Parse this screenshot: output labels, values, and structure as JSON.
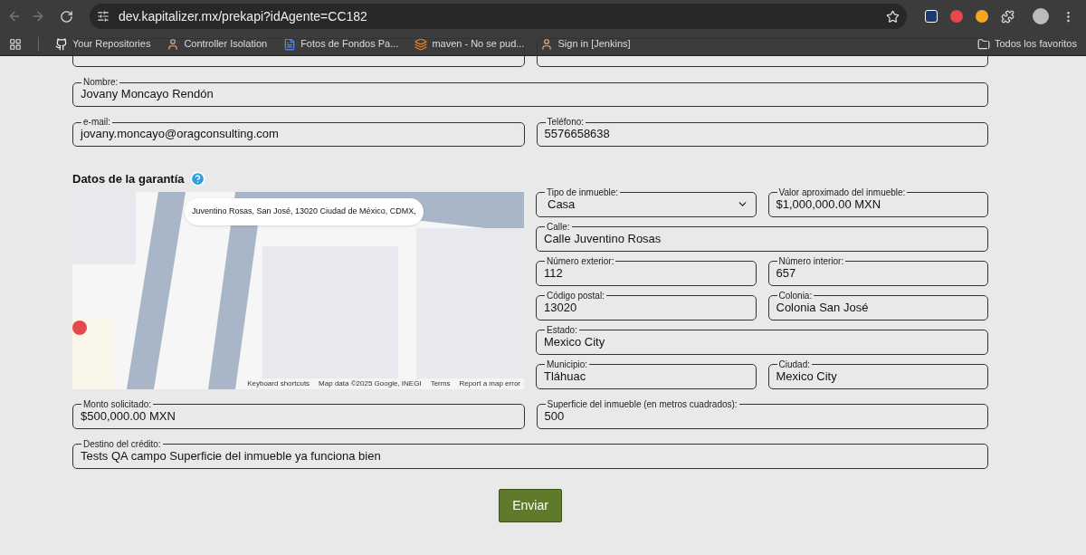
{
  "browser": {
    "url": "dev.kapitalizer.mx/prekapi?idAgente=CC182",
    "bookmarks": [
      {
        "label": "Your Repositories",
        "kind": "github"
      },
      {
        "label": "Controller Isolation",
        "kind": "person"
      },
      {
        "label": "Fotos de Fondos Pa...",
        "kind": "doc"
      },
      {
        "label": "maven - No se pud...",
        "kind": "stack"
      },
      {
        "label": "Sign in [Jenkins]",
        "kind": "person"
      }
    ],
    "all_bookmarks": "Todos los favoritos"
  },
  "personal_rows": [
    [
      {
        "label": "Nombre:",
        "value": "Jovany Moncayo Rendón"
      }
    ],
    [
      {
        "label": "e-mail:",
        "value": "jovany.moncayo@oragconsulting.com"
      },
      {
        "label": "Teléfono:",
        "value": "5576658638"
      }
    ]
  ],
  "guarantee": {
    "title": "Datos de la garantía",
    "map": {
      "address": "Juventino Rosas, San José, 13020 Ciudad de México, CDMX,",
      "attribution": [
        "Keyboard shortcuts",
        "Map data ©2025 Google, INEGI",
        "Terms",
        "Report a map error"
      ]
    },
    "property_rows": [
      [
        {
          "label": "Tipo de inmueble:",
          "value": "Casa",
          "kind": "select"
        },
        {
          "label": "Valor aproximado del inmueble:",
          "value": "$1,000,000.00 MXN",
          "kind": "text"
        }
      ],
      [
        {
          "label": "Calle:",
          "value": "Calle Juventino Rosas",
          "kind": "text"
        }
      ],
      [
        {
          "label": "Número exterior:",
          "value": "112",
          "kind": "text"
        },
        {
          "label": "Número interior:",
          "value": "657",
          "kind": "text"
        }
      ],
      [
        {
          "label": "Código postal:",
          "value": "13020",
          "kind": "text"
        },
        {
          "label": "Colonia:",
          "value": "Colonia San José",
          "kind": "text"
        }
      ],
      [
        {
          "label": "Estado:",
          "value": "Mexico City",
          "kind": "text"
        }
      ],
      [
        {
          "label": "Municipio:",
          "value": "Tláhuac",
          "kind": "text"
        },
        {
          "label": "Ciudad:",
          "value": "Mexico City",
          "kind": "text"
        }
      ]
    ]
  },
  "bottom_rows": [
    [
      {
        "label": "Monto solicitado:",
        "value": "$500,000.00 MXN"
      },
      {
        "label": "Superficie del inmueble (en metros cuadrados):",
        "value": "500"
      }
    ],
    [
      {
        "label": "Destino del crédito:",
        "value": "Tests QA campo Superficie del inmueble ya funciona bien"
      }
    ]
  ],
  "submit": "Enviar"
}
